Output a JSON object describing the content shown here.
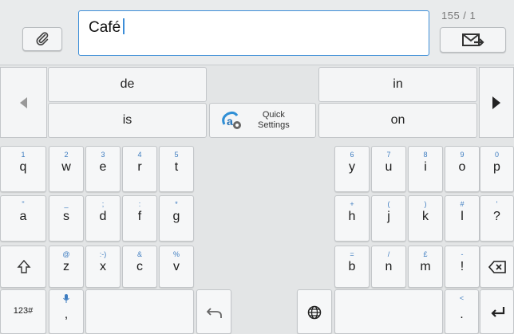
{
  "counter": "155 / 1",
  "input": {
    "value": "Café"
  },
  "suggestions": {
    "left": [
      "de",
      "is"
    ],
    "right": [
      "in",
      "on"
    ],
    "quick_settings_label": "Quick\nSettings"
  },
  "rows": [
    [
      {
        "s": "1",
        "p": "q"
      },
      {
        "s": "2",
        "p": "w"
      },
      {
        "s": "3",
        "p": "e"
      },
      {
        "s": "4",
        "p": "r"
      },
      {
        "s": "5",
        "p": "t"
      },
      {
        "s": "6",
        "p": "y"
      },
      {
        "s": "7",
        "p": "u"
      },
      {
        "s": "8",
        "p": "i"
      },
      {
        "s": "9",
        "p": "o"
      },
      {
        "s": "0",
        "p": "p"
      }
    ],
    [
      {
        "s": "\"",
        "p": "a"
      },
      {
        "s": "_",
        "p": "s"
      },
      {
        "s": ";",
        "p": "d"
      },
      {
        "s": ":",
        "p": "f"
      },
      {
        "s": "*",
        "p": "g"
      },
      {
        "s": "+",
        "p": "h"
      },
      {
        "s": "(",
        "p": "j"
      },
      {
        "s": ")",
        "p": "k"
      },
      {
        "s": "#",
        "p": "l"
      },
      {
        "s": "'",
        "p": "?"
      }
    ],
    [
      {
        "s": "@",
        "p": "z"
      },
      {
        "s": ":-)",
        "p": "x"
      },
      {
        "s": "&",
        "p": "c"
      },
      {
        "s": "%",
        "p": "v"
      },
      {
        "s": "=",
        "p": "b"
      },
      {
        "s": "/",
        "p": "n"
      },
      {
        "s": "£",
        "p": "m"
      },
      {
        "s": "-",
        "p": "!"
      }
    ]
  ],
  "bottom": {
    "numbers_label": "123#",
    "comma": ",",
    "comma_secondary": "🎤",
    "period": ".",
    "period_secondary": "<"
  },
  "colors": {
    "accent": "#3d8ed8",
    "secondary_text": "#3d7cc0"
  }
}
